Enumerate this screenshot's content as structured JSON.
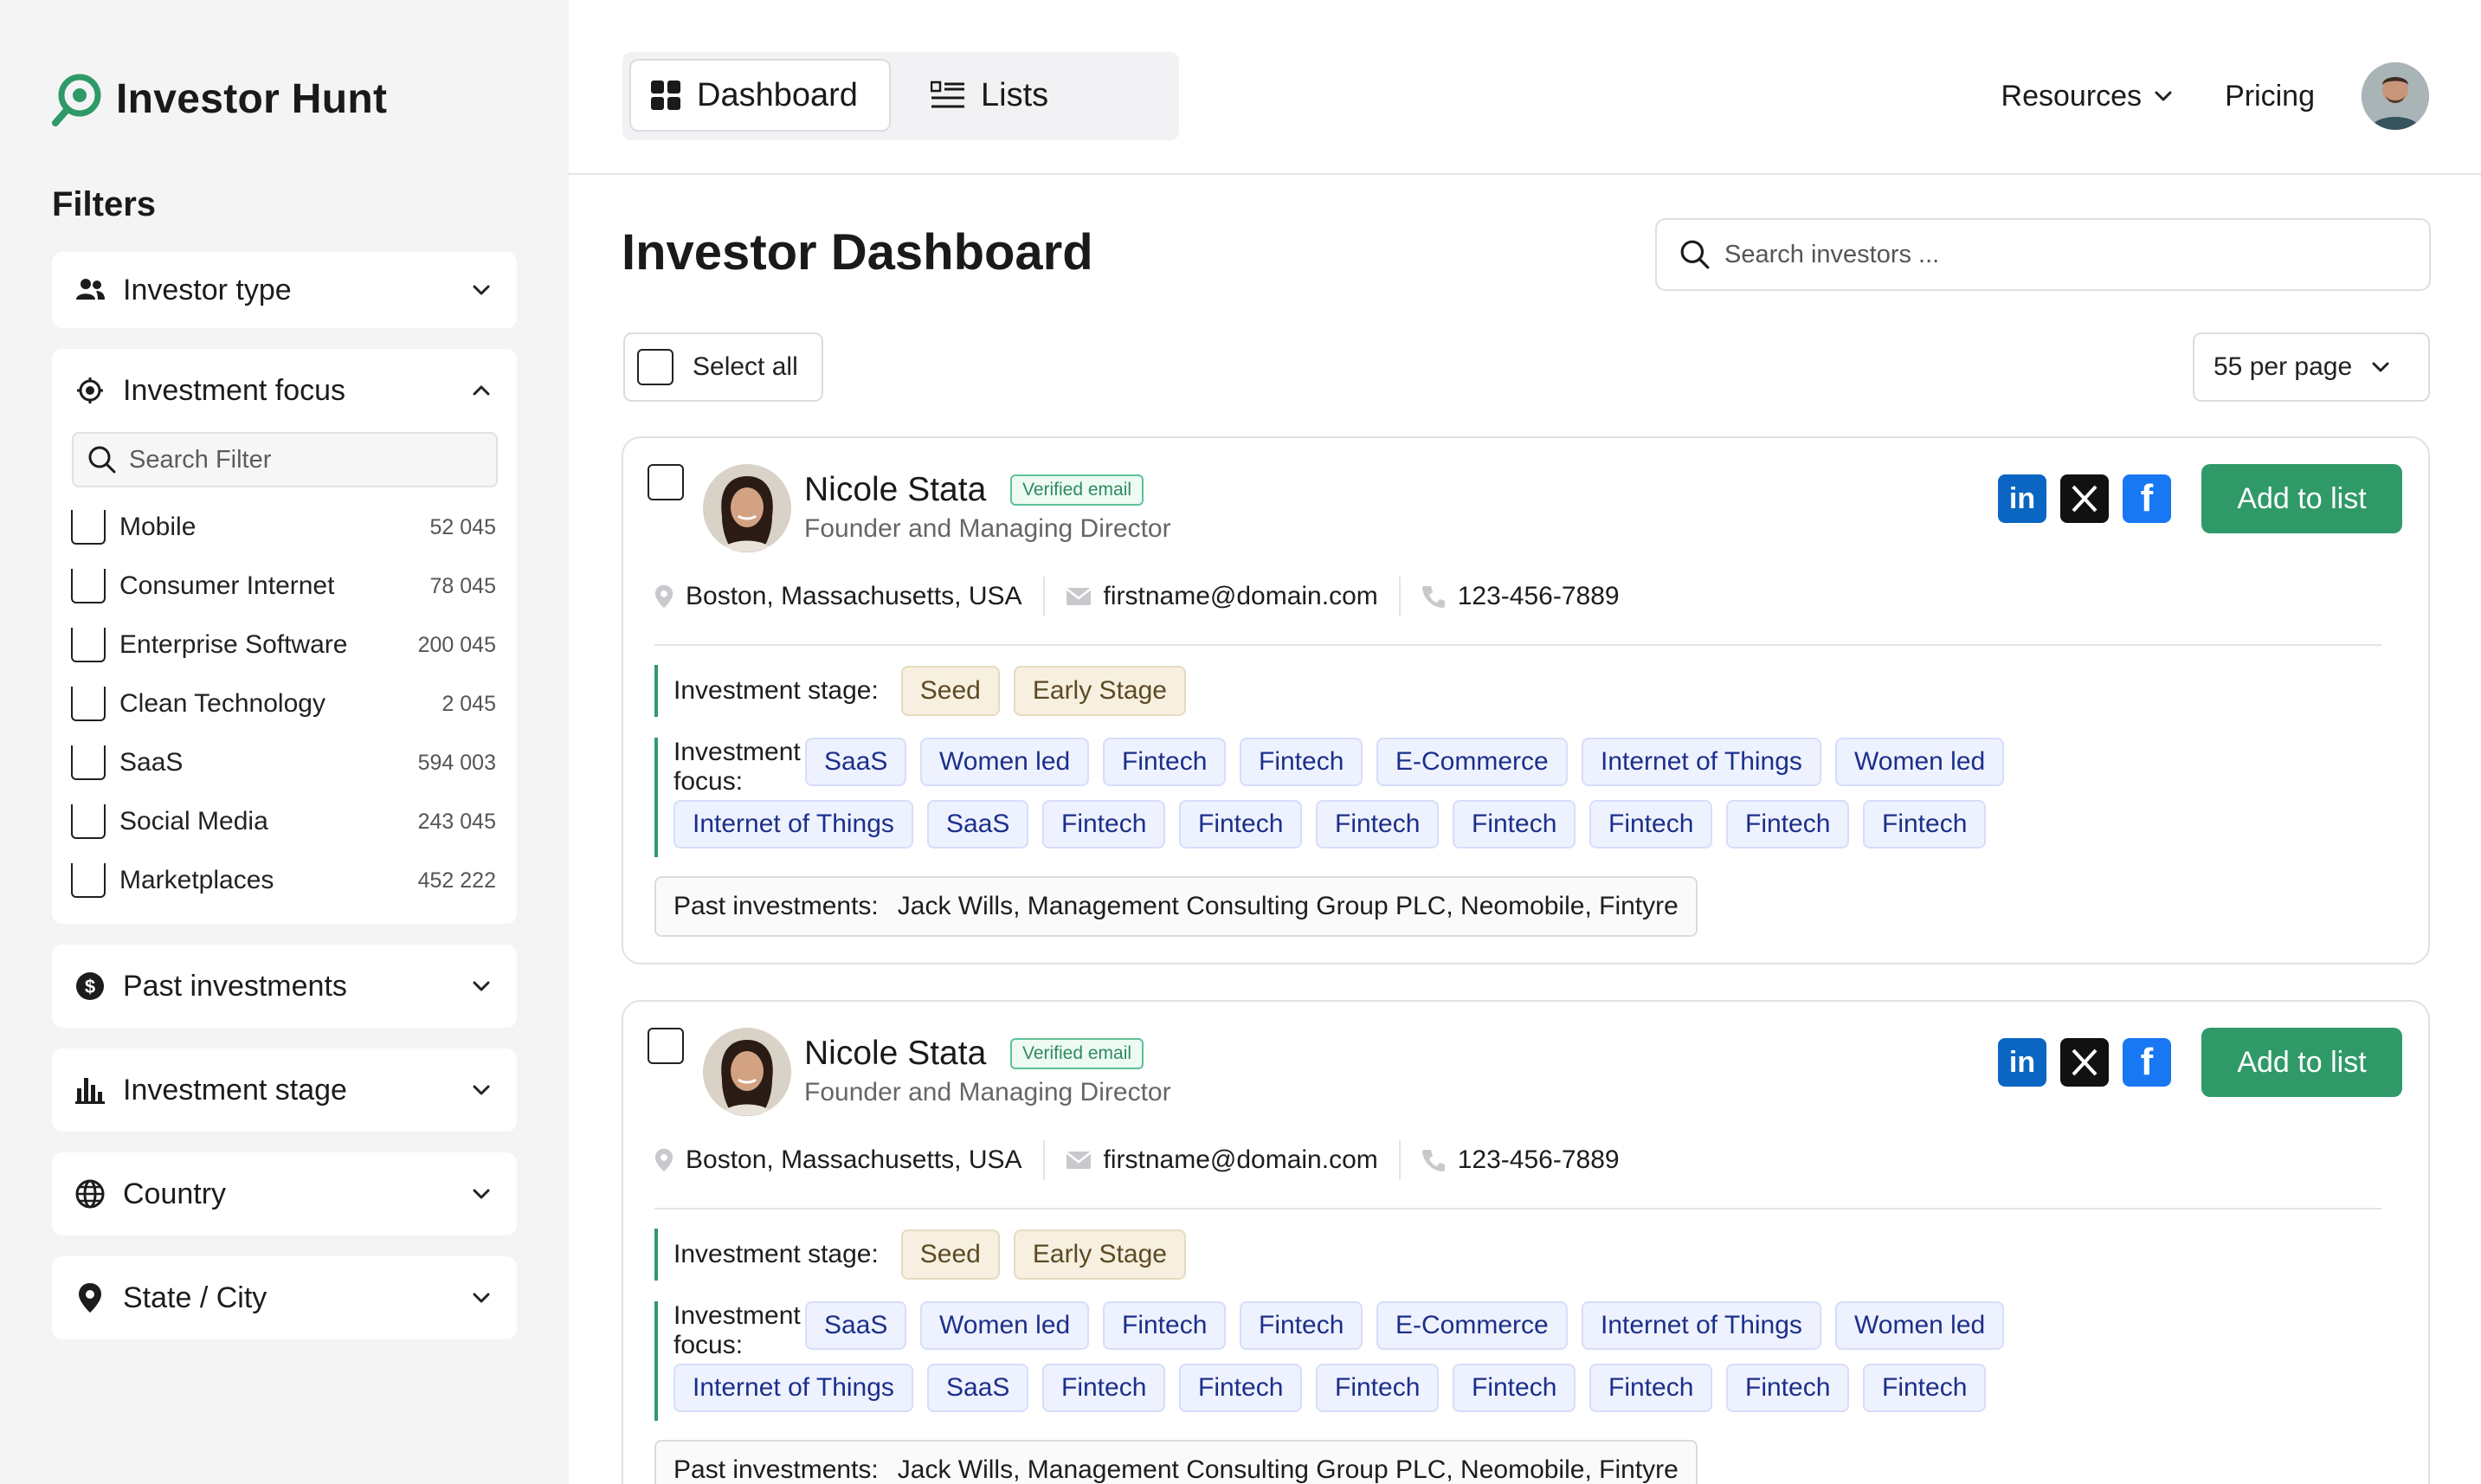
{
  "app": {
    "name": "Investor Hunt",
    "brand_color": "#2f9a68"
  },
  "sidebar": {
    "filters_title": "Filters",
    "investor_type": {
      "label": "Investor type",
      "icon": "users-icon"
    },
    "investment_focus": {
      "label": "Investment focus",
      "icon": "target-icon",
      "search_placeholder": "Search Filter",
      "items": [
        {
          "name": "Mobile",
          "count": "52 045"
        },
        {
          "name": "Consumer Internet",
          "count": "78 045"
        },
        {
          "name": "Enterprise Software",
          "count": "200 045"
        },
        {
          "name": "Clean Technology",
          "count": "2 045"
        },
        {
          "name": "SaaS",
          "count": "594 003"
        },
        {
          "name": "Social Media",
          "count": "243 045"
        },
        {
          "name": "Marketplaces",
          "count": "452 222"
        }
      ]
    },
    "past_investments": {
      "label": "Past investments",
      "icon": "dollar-icon"
    },
    "investment_stage": {
      "label": "Investment stage",
      "icon": "bar-chart-icon"
    },
    "country": {
      "label": "Country",
      "icon": "globe-icon"
    },
    "state_city": {
      "label": "State / City",
      "icon": "pin-icon"
    }
  },
  "nav": {
    "tabs": [
      {
        "label": "Dashboard",
        "icon": "grid-icon",
        "active": true
      },
      {
        "label": "Lists",
        "icon": "list-icon",
        "active": false
      }
    ],
    "resources": "Resources",
    "pricing": "Pricing"
  },
  "main": {
    "title": "Investor Dashboard",
    "search_placeholder": "Search investors ...",
    "select_all": "Select all",
    "per_page": "55 per page"
  },
  "investors": [
    {
      "name": "Nicole Stata",
      "badge": "Verified email",
      "title": "Founder and Managing Director",
      "location": "Boston, Massachusetts, USA",
      "email": "firstname@domain.com",
      "phone": "123-456-7889",
      "add_label": "Add to list",
      "stage_label": "Investment stage:",
      "stages": [
        "Seed",
        "Early Stage"
      ],
      "focus_label": "Investment focus:",
      "focus": [
        "SaaS",
        "Women led",
        "Fintech",
        "Fintech",
        "E-Commerce",
        "Internet of Things",
        "Women led",
        "Internet of Things",
        "SaaS",
        "Fintech",
        "Fintech",
        "Fintech",
        "Fintech",
        "Fintech",
        "Fintech",
        "Fintech"
      ],
      "past_label": "Past investments:",
      "past": "Jack Wills, Management Consulting Group PLC, Neomobile, Fintyre"
    },
    {
      "name": "Nicole Stata",
      "badge": "Verified email",
      "title": "Founder and Managing Director",
      "location": "Boston, Massachusetts, USA",
      "email": "firstname@domain.com",
      "phone": "123-456-7889",
      "add_label": "Add to list",
      "stage_label": "Investment stage:",
      "stages": [
        "Seed",
        "Early Stage"
      ],
      "focus_label": "Investment focus:",
      "focus": [
        "SaaS",
        "Women led",
        "Fintech",
        "Fintech",
        "E-Commerce",
        "Internet of Things",
        "Women led",
        "Internet of Things",
        "SaaS",
        "Fintech",
        "Fintech",
        "Fintech",
        "Fintech",
        "Fintech",
        "Fintech",
        "Fintech"
      ],
      "past_label": "Past investments:",
      "past": "Jack Wills, Management Consulting Group PLC, Neomobile, Fintyre"
    }
  ]
}
